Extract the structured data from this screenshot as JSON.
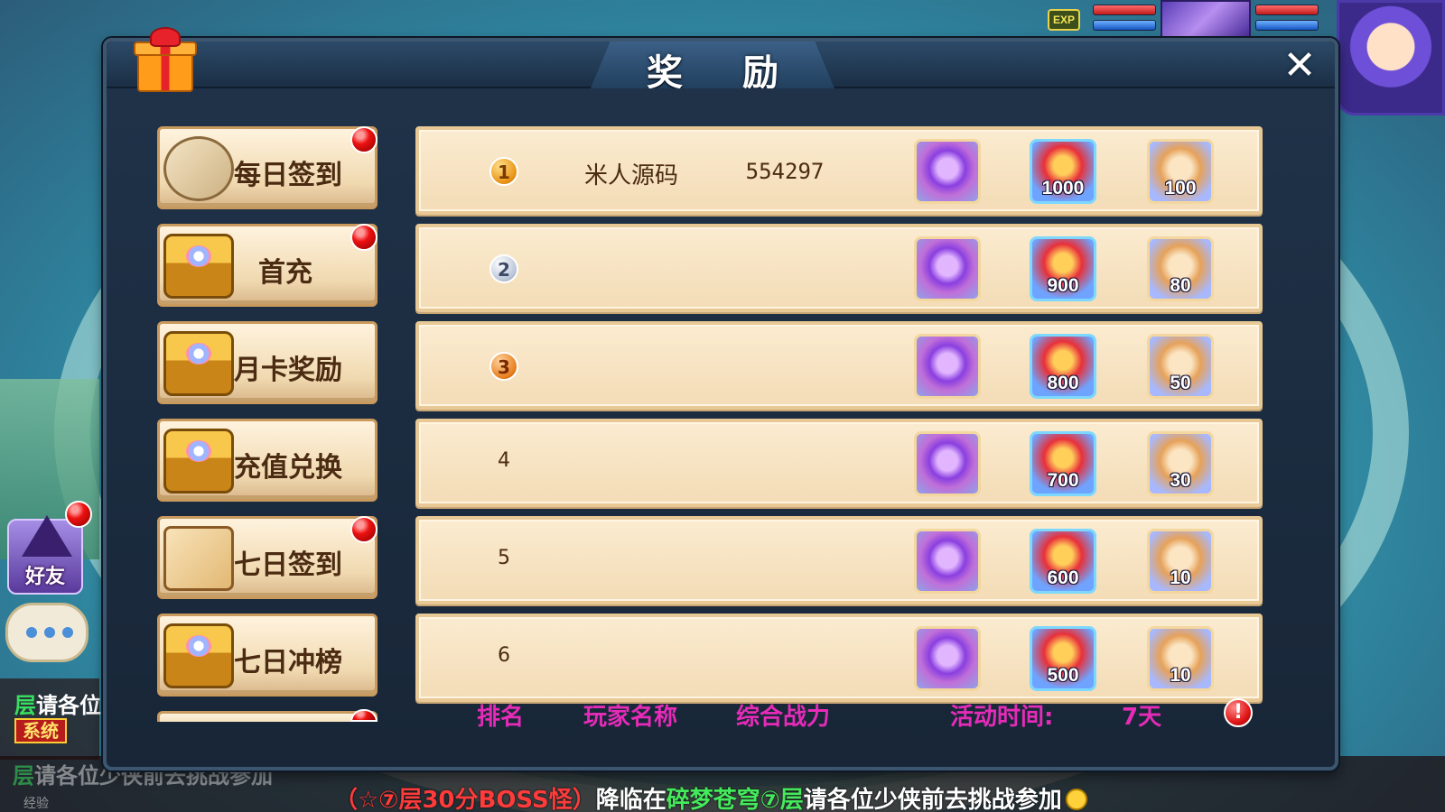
{
  "dialog": {
    "title": "奖 励",
    "close_label": "✕"
  },
  "hud": {
    "exp_label": "EXP"
  },
  "menu": [
    {
      "label": "每日签到",
      "icon": "scroll-icon",
      "badge": true
    },
    {
      "label": "首充",
      "icon": "treasure-chest-icon",
      "badge": true
    },
    {
      "label": "月卡奖励",
      "icon": "treasure-chest-icon",
      "badge": false
    },
    {
      "label": "充值兑换",
      "icon": "treasure-chest-icon",
      "badge": false
    },
    {
      "label": "七日签到",
      "icon": "map-scroll-icon",
      "badge": true
    },
    {
      "label": "七日冲榜",
      "icon": "treasure-chest-icon",
      "badge": false
    }
  ],
  "rows": [
    {
      "rank": "1",
      "rank_style": "gold",
      "player": "米人源码",
      "power": "554297",
      "gift_count": "1000",
      "bag_count": "100"
    },
    {
      "rank": "2",
      "rank_style": "silver",
      "player": "",
      "power": "",
      "gift_count": "900",
      "bag_count": "80"
    },
    {
      "rank": "3",
      "rank_style": "bronze",
      "player": "",
      "power": "",
      "gift_count": "800",
      "bag_count": "50"
    },
    {
      "rank": "4",
      "rank_style": "plain",
      "player": "",
      "power": "",
      "gift_count": "700",
      "bag_count": "30"
    },
    {
      "rank": "5",
      "rank_style": "plain",
      "player": "",
      "power": "",
      "gift_count": "600",
      "bag_count": "10"
    },
    {
      "rank": "6",
      "rank_style": "plain",
      "player": "",
      "power": "",
      "gift_count": "500",
      "bag_count": "10"
    }
  ],
  "footer": {
    "rank_header": "排名",
    "player_header": "玩家名称",
    "power_header": "综合战力",
    "time_label": "活动时间:",
    "time_value": "7天",
    "info_icon": "!"
  },
  "side": {
    "friend_label": "好友",
    "chat_prefix": "层",
    "chat_text": "请各位",
    "system_tag": "系统",
    "ghost_line_prefix": "层",
    "ghost_line_text": "请各位少侠前去挑战参加"
  },
  "marquee": {
    "part1": "（☆⑦层30分BOSS怪）",
    "part2": "降临在",
    "part3": "碎梦苍穹⑦层",
    "part4": "请各位少侠前去挑战参加"
  },
  "exp_bar_label": "经验",
  "colors": {
    "footer_header": "#e52bb8",
    "menu_text": "#4b2b12",
    "dialog_bg": "#1b2f45",
    "row_bg": "#f3dcb6"
  }
}
